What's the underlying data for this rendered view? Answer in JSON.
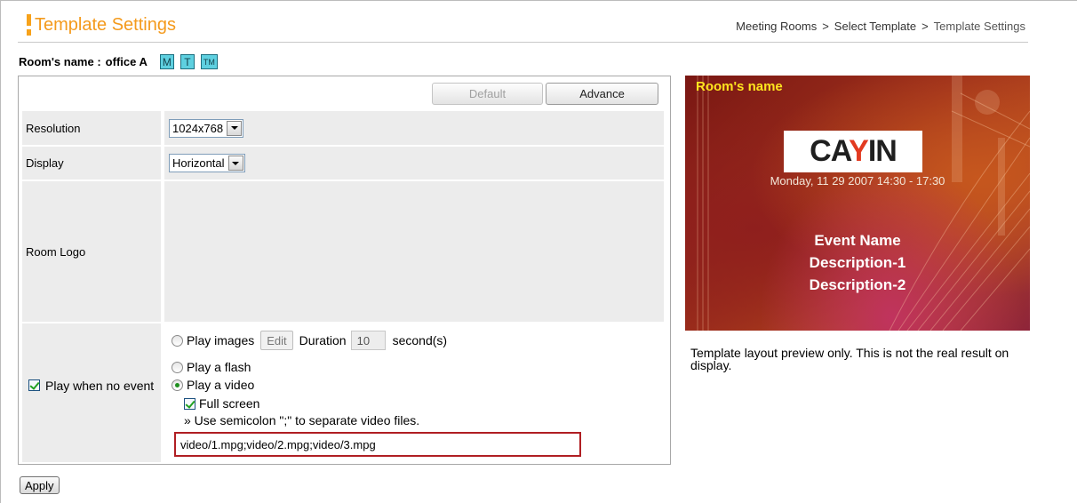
{
  "header": {
    "title": "Template Settings",
    "breadcrumb": [
      "Meeting Rooms",
      "Select Template",
      "Template Settings"
    ],
    "breadcrumb_separator": ">"
  },
  "room": {
    "label": "Room's name :",
    "value": "office A",
    "mode_buttons": [
      "M",
      "T",
      "TM"
    ]
  },
  "toolbar": {
    "default_label": "Default",
    "advance_label": "Advance"
  },
  "form": {
    "resolution": {
      "label": "Resolution",
      "value": "1024x768"
    },
    "display": {
      "label": "Display",
      "value": "Horizontal"
    },
    "room_logo": {
      "label": "Room Logo"
    },
    "play_when_no_event": {
      "label": "Play when no event",
      "checked": true,
      "play_images_label": "Play images",
      "edit_label": "Edit",
      "duration_label": "Duration",
      "duration_value": "10",
      "duration_unit": "second(s)",
      "play_flash_label": "Play a flash",
      "play_video_label": "Play a video",
      "selected": "Play a video",
      "full_screen_label": "Full screen",
      "full_screen_checked": true,
      "hint": "» Use semicolon \";\" to separate video files.",
      "video_files": "video/1.mpg;video/2.mpg;video/3.mpg"
    }
  },
  "apply_label": "Apply",
  "preview": {
    "room_name": "Room's name",
    "logo": "CAYIN",
    "datetime": "Monday, 11 29 2007 14:30 - 17:30",
    "event_name": "Event Name",
    "description_1": "Description-1",
    "description_2": "Description-2",
    "note": "Template layout preview only. This is not the real result on display."
  },
  "colors": {
    "title": "#f49a1c",
    "mode_button": "#5ed0e0",
    "highlight_border": "#b01e23",
    "preview_room_name": "#ffe51e"
  }
}
